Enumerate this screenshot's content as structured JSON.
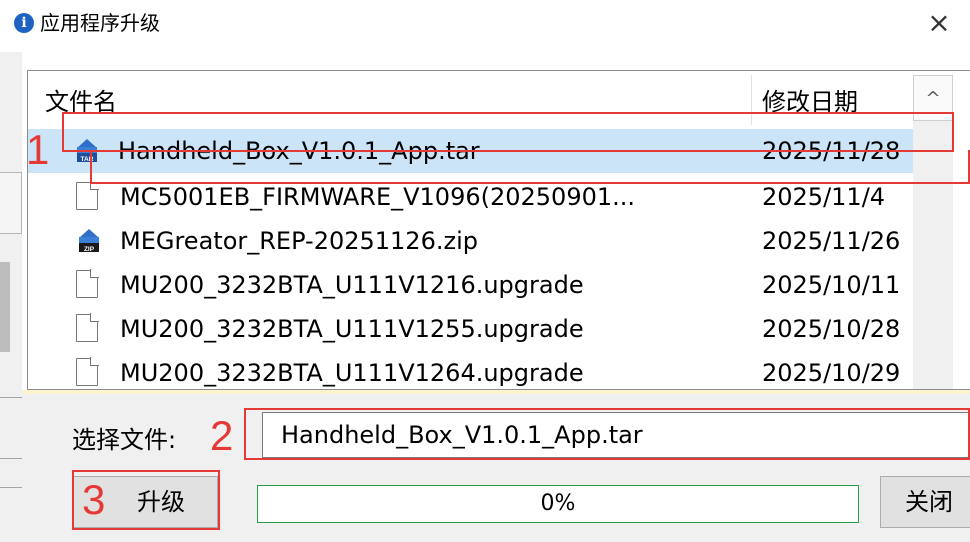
{
  "window": {
    "title": "应用程序升级",
    "close_glyph": "×",
    "title_icon": "info-icon"
  },
  "file_list": {
    "columns": {
      "name": "文件名",
      "date": "修改日期"
    },
    "scroll_up_glyph": "^",
    "rows": [
      {
        "name": "Handheld_Box_V1.0.1_App.tar",
        "date": "2025/11/28",
        "icon": "tar-archive-icon",
        "selected": true
      },
      {
        "name": "MC5001EB_FIRMWARE_V1096(20250901...",
        "date": "2025/11/4",
        "icon": "file-icon"
      },
      {
        "name": "MEGreator_REP-20251126.zip",
        "date": "2025/11/26",
        "icon": "zip-archive-icon"
      },
      {
        "name": "MU200_3232BTA_U111V1216.upgrade",
        "date": "2025/10/11",
        "icon": "file-icon"
      },
      {
        "name": "MU200_3232BTA_U111V1255.upgrade",
        "date": "2025/10/28",
        "icon": "file-icon"
      },
      {
        "name": "MU200_3232BTA_U111V1264.upgrade",
        "date": "2025/10/29",
        "icon": "file-icon"
      }
    ]
  },
  "select_file": {
    "label": "选择文件:",
    "value": "Handheld_Box_V1.0.1_App.tar"
  },
  "actions": {
    "upgrade_label": "升级",
    "close_label": "关闭"
  },
  "progress": {
    "fraction": 0,
    "text": "0%"
  },
  "annotations": [
    {
      "number": "1"
    },
    {
      "number": "2"
    },
    {
      "number": "3"
    }
  ],
  "colors": {
    "annotation": "#e53935",
    "selection": "#cce4f7",
    "progress_border": "#2a9d4a",
    "info_icon": "#1e63c4"
  }
}
